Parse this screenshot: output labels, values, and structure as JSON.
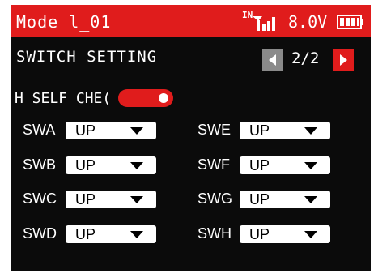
{
  "header": {
    "model_name": "Mode l_01",
    "input_label": "IN",
    "voltage": "8.0V"
  },
  "page": {
    "title": "SWITCH SETTING",
    "indicator": "2/2"
  },
  "self_check": {
    "label": "H SELF CHE(",
    "enabled": true
  },
  "switches": [
    {
      "name": "SWA",
      "value": "UP"
    },
    {
      "name": "SWB",
      "value": "UP"
    },
    {
      "name": "SWC",
      "value": "UP"
    },
    {
      "name": "SWD",
      "value": "UP"
    },
    {
      "name": "SWE",
      "value": "UP"
    },
    {
      "name": "SWF",
      "value": "UP"
    },
    {
      "name": "SWG",
      "value": "UP"
    },
    {
      "name": "SWH",
      "value": "UP"
    }
  ],
  "icons": [
    "signal-icon",
    "battery-icon",
    "arrow-left-icon",
    "arrow-right-icon",
    "chevron-down-icon"
  ],
  "colors": {
    "accent": "#e01c1c",
    "background": "#0b0b0b",
    "disabled_button": "#8a8a8a"
  }
}
